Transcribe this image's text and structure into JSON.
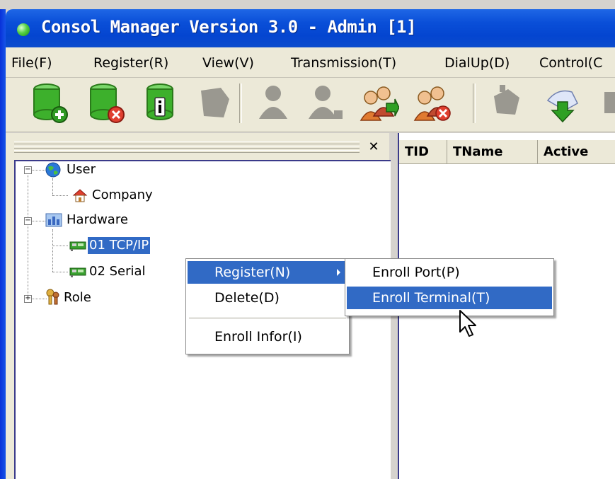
{
  "window": {
    "title": "Consol Manager Version 3.0 - Admin [1]",
    "colors": {
      "titlebar": "#0445d0",
      "highlight": "#316ac5",
      "chrome": "#ece9d8"
    }
  },
  "menubar": {
    "items": [
      "File(F)",
      "Register(R)",
      "View(V)",
      "Transmission(T)",
      "DialUp(D)",
      "Control(C"
    ]
  },
  "toolbar": {
    "icons": [
      "db-add-icon",
      "db-delete-icon",
      "db-info-icon",
      "disabled-icon",
      "user-disabled-icon",
      "user-disabled-icon-2",
      "users-add-icon",
      "users-delete-icon",
      "transfer-disabled-icon",
      "download-icon",
      "extra-icon"
    ]
  },
  "tree": {
    "close_symbol": "✕",
    "nodes": [
      {
        "label": "User",
        "expander": "−"
      },
      {
        "label": "Company"
      },
      {
        "label": "Hardware",
        "expander": "−"
      },
      {
        "label": "01 TCP/IP",
        "selected": true
      },
      {
        "label": "02 Serial"
      },
      {
        "label": "Role",
        "expander": "+"
      }
    ]
  },
  "list": {
    "columns": [
      "TID",
      "TName",
      "Active"
    ]
  },
  "context_menu": {
    "items": [
      {
        "label": "Register(N)",
        "highlighted": true,
        "submenu": true
      },
      {
        "label": "Delete(D)"
      },
      {
        "label": "Enroll Infor(I)"
      }
    ]
  },
  "submenu": {
    "items": [
      {
        "label": "Enroll Port(P)"
      },
      {
        "label": "Enroll Terminal(T)",
        "highlighted": true
      }
    ]
  }
}
